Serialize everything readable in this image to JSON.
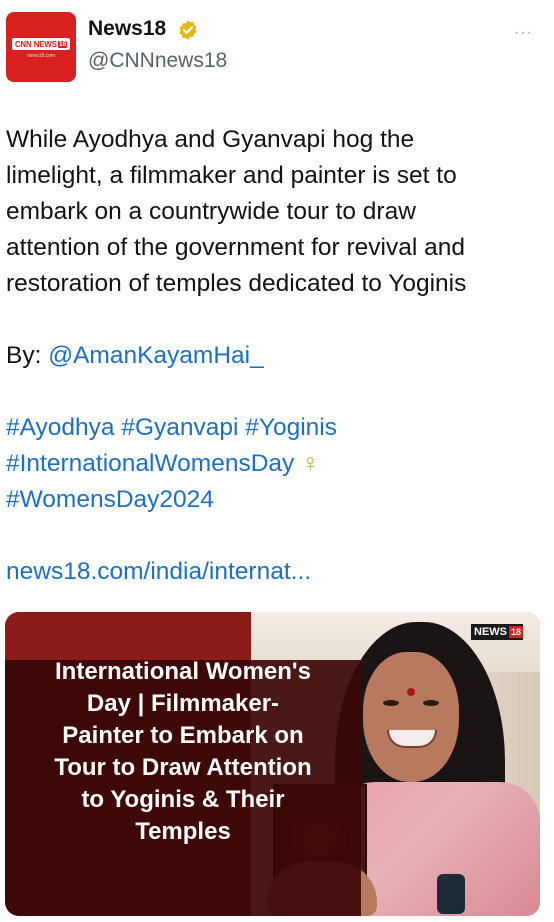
{
  "tweet": {
    "author": {
      "display_name": "News18",
      "handle": "@CNNnews18",
      "avatar_logo_text": "CNN NEWS",
      "avatar_logo_number": "18",
      "avatar_url_text": "news18.com",
      "verified_icon": "verified-badge-icon"
    },
    "more_menu_label": "···",
    "text_lines": [
      "While Ayodhya and Gyanvapi hog the",
      "limelight, a filmmaker and painter is set to",
      "embark on a countrywide tour to draw",
      "attention of the government for revival and",
      "restoration of temples dedicated to Yoginis"
    ],
    "by_label": "By: ",
    "by_mention": "@AmanKayamHai_",
    "hashtags_line1": "#Ayodhya #Gyanvapi #Yoginis",
    "hashtags_line2": "#InternationalWomensDay",
    "venus_symbol": "♀",
    "hashtags_line3": "#WomensDay2024",
    "link": "news18.com/india/internat...",
    "card": {
      "headline_lines": [
        "International Women's",
        "Day | Filmmaker-",
        "Painter to Embark on",
        "Tour to Draw Attention",
        "to Yoginis & Their",
        "Temples"
      ],
      "badge_text": "NEWS",
      "badge_number": "18"
    }
  },
  "colors": {
    "link": "#1d6fc6",
    "brand_red": "#d9201f",
    "verified_gold": "#e2b719",
    "card_overlay": "#3a0808"
  }
}
